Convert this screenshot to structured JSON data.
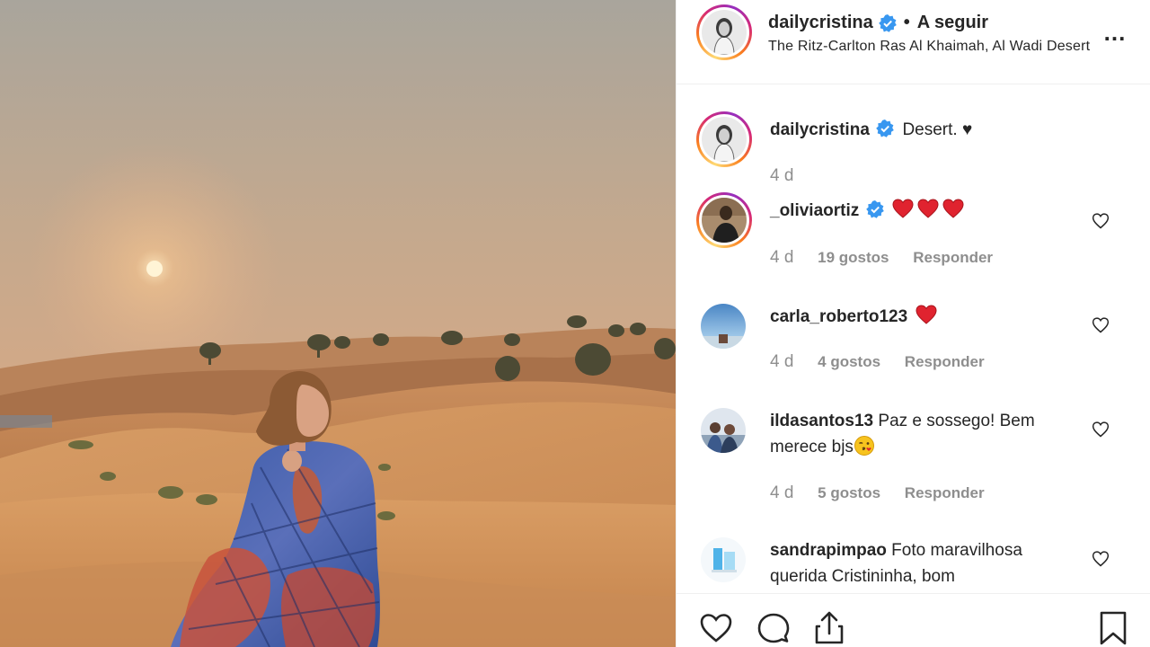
{
  "post": {
    "username": "dailycristina",
    "follow_separator": "•",
    "follow_label": "A seguir",
    "location": "The Ritz-Carlton Ras Al Khaimah, Al Wadi Desert",
    "more_label": "..."
  },
  "caption": {
    "username": "dailycristina",
    "text": "Desert. ♥",
    "time": "4 d"
  },
  "comments": [
    {
      "username": "_oliviaortiz",
      "verified": true,
      "text": "",
      "emoji": "three-red-hearts",
      "time": "4 d",
      "likes": "19 gostos",
      "reply": "Responder"
    },
    {
      "username": "carla_roberto123",
      "verified": false,
      "text": "",
      "emoji": "red-heart",
      "time": "4 d",
      "likes": "4 gostos",
      "reply": "Responder"
    },
    {
      "username": "ildasantos13",
      "verified": false,
      "text": "Paz e sossego! Bem merece bjs",
      "emoji": "face-blowing-kiss",
      "time": "4 d",
      "likes": "5 gostos",
      "reply": "Responder"
    },
    {
      "username": "sandrapimpao",
      "verified": false,
      "text": "Foto maravilhosa querida Cristininha, bom",
      "emoji": "",
      "time": "",
      "likes": "",
      "reply": ""
    }
  ],
  "icons": {
    "like": "heart-outline-icon",
    "comment": "comment-bubble-icon",
    "share": "share-icon",
    "save": "bookmark-icon",
    "verified": "verified-badge-icon"
  },
  "colors": {
    "accent_verified": "#3897f0",
    "meta_gray": "#8e8e8e",
    "heart_red": "#e0232f"
  }
}
